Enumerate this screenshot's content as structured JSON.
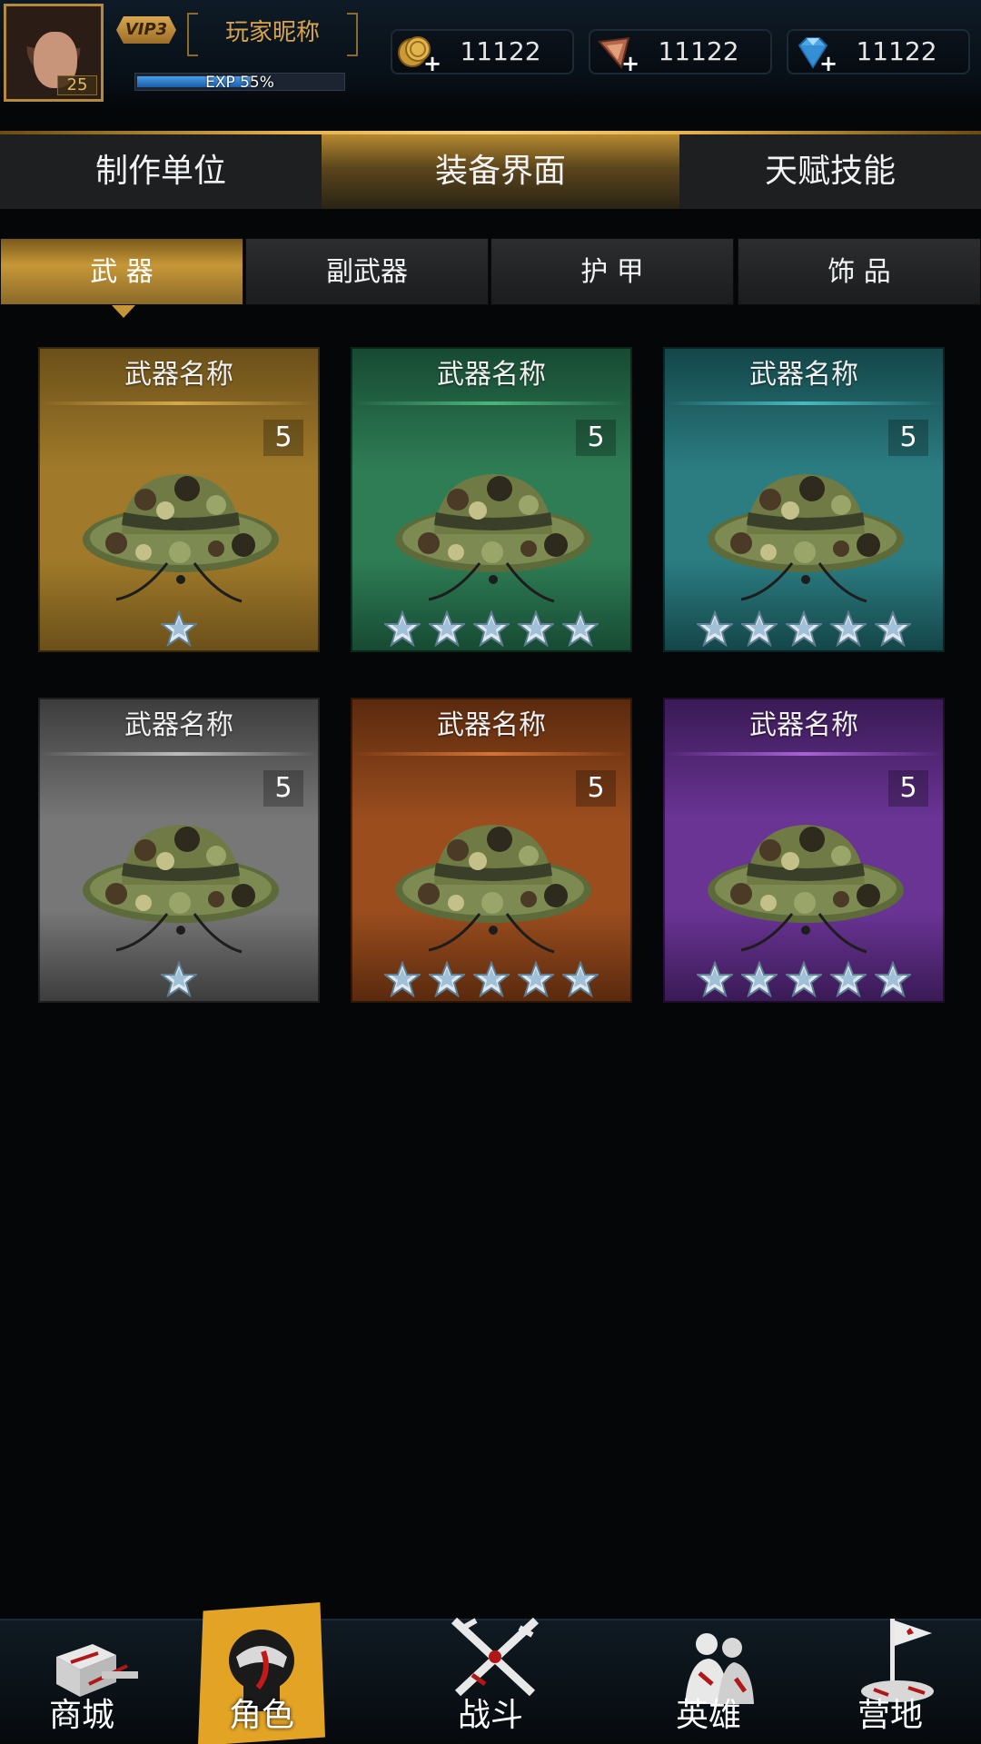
{
  "player": {
    "vip": "VIP3",
    "nickname": "玩家昵称",
    "level": "25",
    "exp_label": "EXP 55%",
    "exp_fraction": 0.55
  },
  "currencies": [
    {
      "name": "gold-coin-icon",
      "value": "11122"
    },
    {
      "name": "badge-token-icon",
      "value": "11122"
    },
    {
      "name": "diamond-icon",
      "value": "11122"
    }
  ],
  "main_tabs": [
    {
      "label": "制作单位",
      "active": false
    },
    {
      "label": "装备界面",
      "active": true
    },
    {
      "label": "天赋技能",
      "active": false
    }
  ],
  "sub_tabs": [
    {
      "label": "武 器",
      "active": true
    },
    {
      "label": "副武器",
      "active": false
    },
    {
      "label": "护 甲",
      "active": false
    },
    {
      "label": "饰 品",
      "active": false
    }
  ],
  "items": [
    {
      "name": "武器名称",
      "count": "5",
      "stars": 1,
      "color": "#a07a2a",
      "color_dark": "#6b501a",
      "accent": "#e0b050"
    },
    {
      "name": "武器名称",
      "count": "5",
      "stars": 5,
      "color": "#2e7d55",
      "color_dark": "#174a33",
      "accent": "#50c080"
    },
    {
      "name": "武器名称",
      "count": "5",
      "stars": 5,
      "color": "#2b7d82",
      "color_dark": "#144649",
      "accent": "#4ec4c8"
    },
    {
      "name": "武器名称",
      "count": "5",
      "stars": 1,
      "color": "#777777",
      "color_dark": "#3d3d3d",
      "accent": "#c8c8c8"
    },
    {
      "name": "武器名称",
      "count": "5",
      "stars": 5,
      "color": "#9b4d1e",
      "color_dark": "#5a2a0e",
      "accent": "#e07a3a"
    },
    {
      "name": "武器名称",
      "count": "5",
      "stars": 5,
      "color": "#6a3495",
      "color_dark": "#3a1a55",
      "accent": "#b06ae0"
    }
  ],
  "bottom_nav": [
    {
      "label": "商城",
      "icon": "shop-icon",
      "active": false
    },
    {
      "label": "角色",
      "icon": "character-icon",
      "active": true
    },
    {
      "label": "战斗",
      "icon": "battle-icon",
      "active": false
    },
    {
      "label": "英雄",
      "icon": "hero-icon",
      "active": false
    },
    {
      "label": "营地",
      "icon": "camp-flag-icon",
      "active": false
    }
  ]
}
